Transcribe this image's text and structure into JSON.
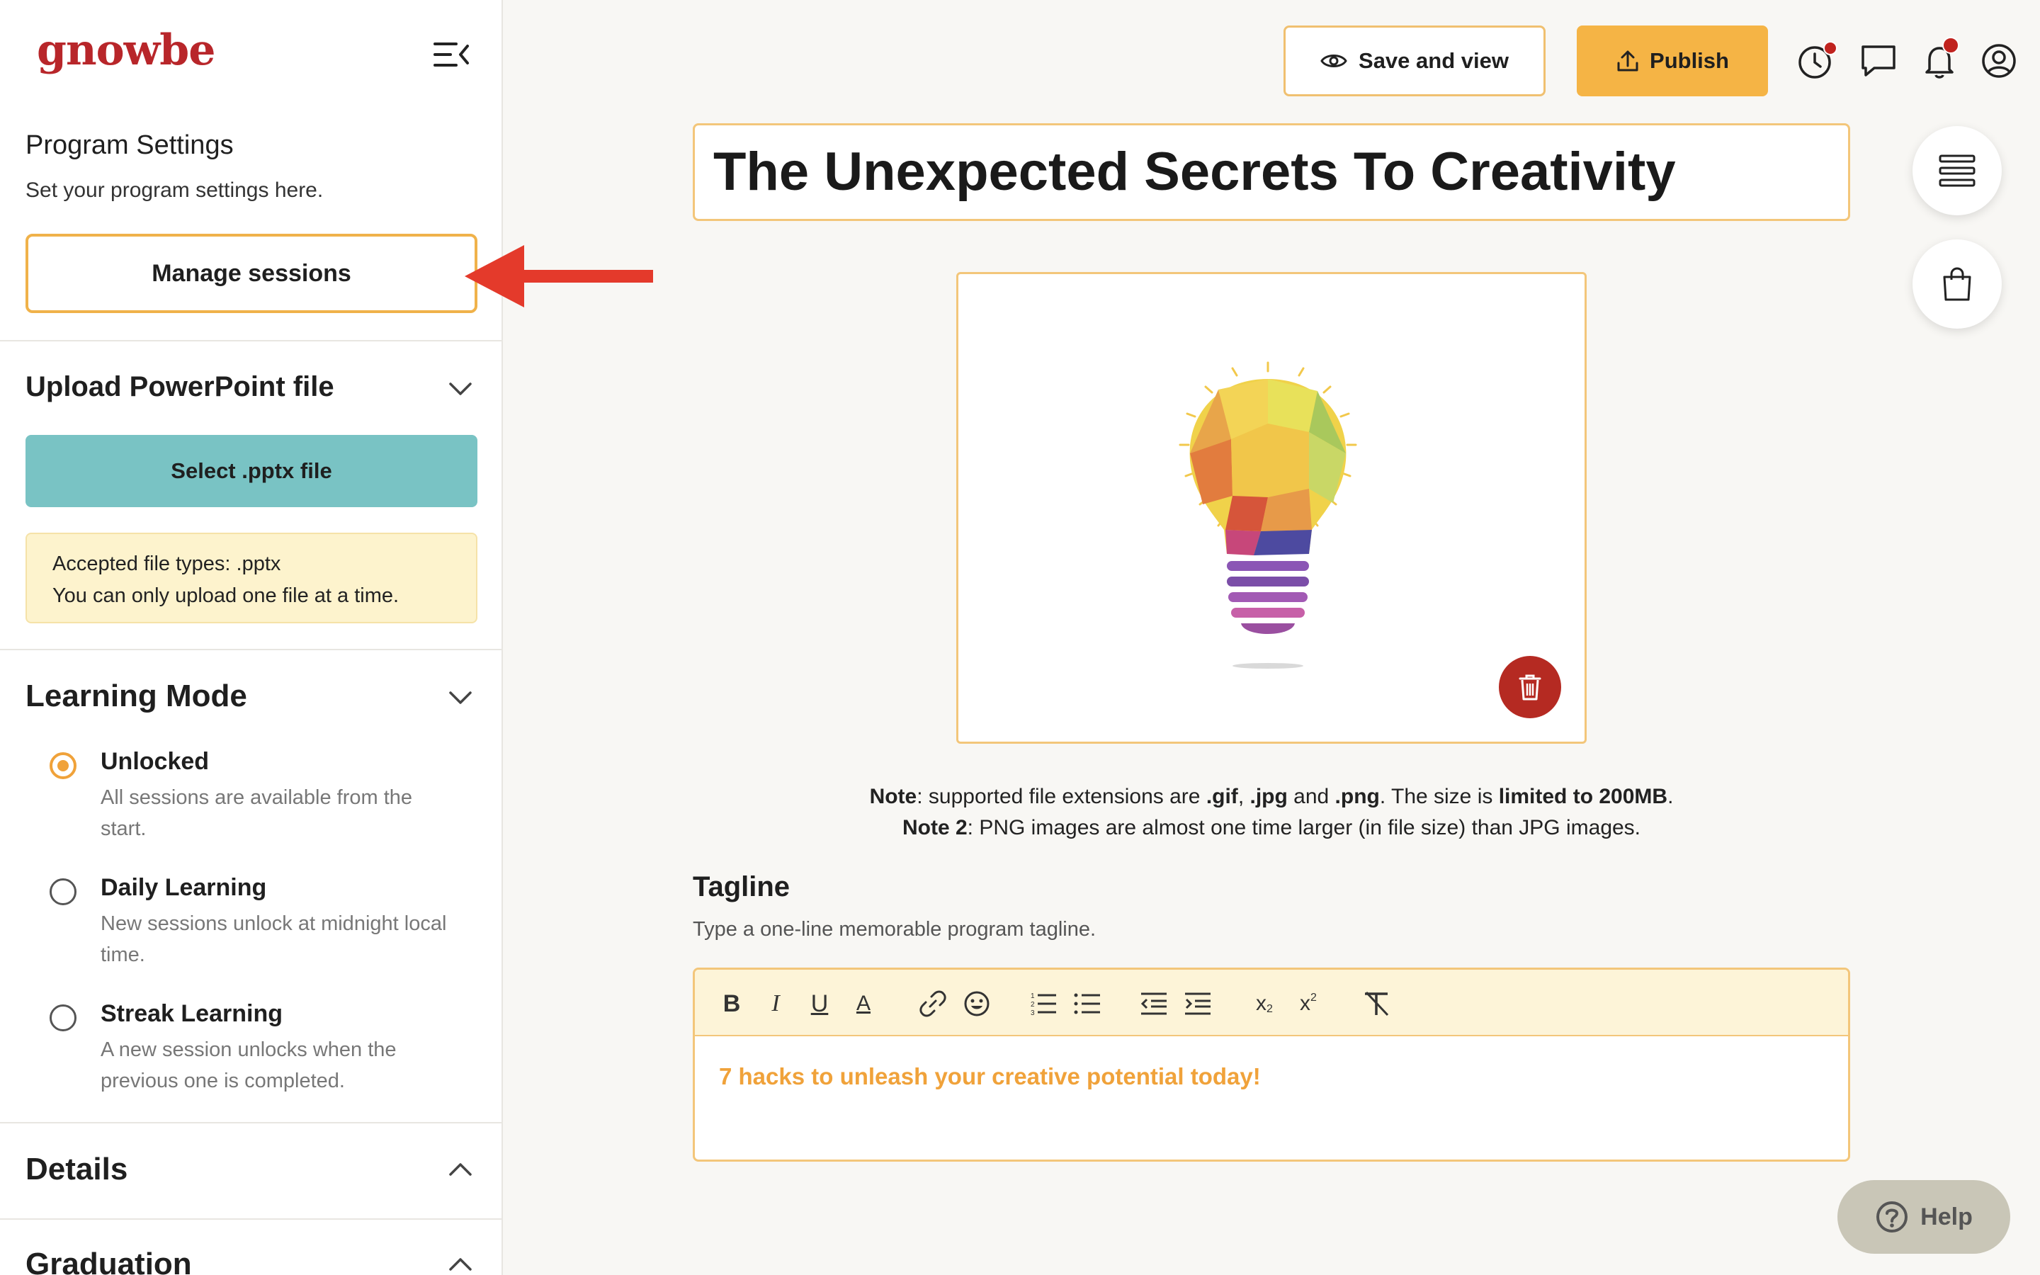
{
  "brand": {
    "logo": "gnowbe"
  },
  "sidebar": {
    "heading": "Program Settings",
    "subheading": "Set your program settings here.",
    "manage_sessions": "Manage sessions",
    "upload": {
      "title": "Upload PowerPoint file",
      "button": "Select .pptx file",
      "info_line1": "Accepted file types: .pptx",
      "info_line2": "You can only upload one file at a time."
    },
    "learning_mode": {
      "title": "Learning Mode",
      "options": [
        {
          "label": "Unlocked",
          "desc": "All sessions are available from the start.",
          "selected": true
        },
        {
          "label": "Daily Learning",
          "desc": "New sessions unlock at midnight local time.",
          "selected": false
        },
        {
          "label": "Streak Learning",
          "desc": "A new session unlocks when the previous one is completed.",
          "selected": false
        }
      ]
    },
    "details": {
      "title": "Details"
    },
    "graduation": {
      "title": "Graduation"
    }
  },
  "topbar": {
    "save_view": "Save and view",
    "publish": "Publish",
    "icons": [
      "clock-icon",
      "chat-icon",
      "bell-icon",
      "account-icon"
    ]
  },
  "main": {
    "title": "The Unexpected Secrets To Creativity",
    "note1": {
      "label": "Note",
      "t1": ": supported file extensions are ",
      "gif": ".gif",
      "comma": ", ",
      "jpg": ".jpg",
      "and": " and ",
      "png": ".png",
      "t2": ". The size is ",
      "limit": "limited to 200MB",
      "end": "."
    },
    "note2": {
      "label": "Note 2",
      "text": ": PNG images are almost one time larger (in file size) than JPG images."
    },
    "tagline": {
      "title": "Tagline",
      "subtitle": "Type a one-line memorable program tagline.",
      "value": "7 hacks to unleash your creative potential today!"
    }
  },
  "help": {
    "label": "Help"
  },
  "colors": {
    "accent_orange": "#f0a23a",
    "publish_bg": "#f5b445",
    "teal_button": "#79c3c4",
    "brand_red": "#b8262a",
    "delete_red": "#b52a22",
    "info_yellow": "#fdf3cd",
    "arrow_red": "#e43a2b"
  }
}
